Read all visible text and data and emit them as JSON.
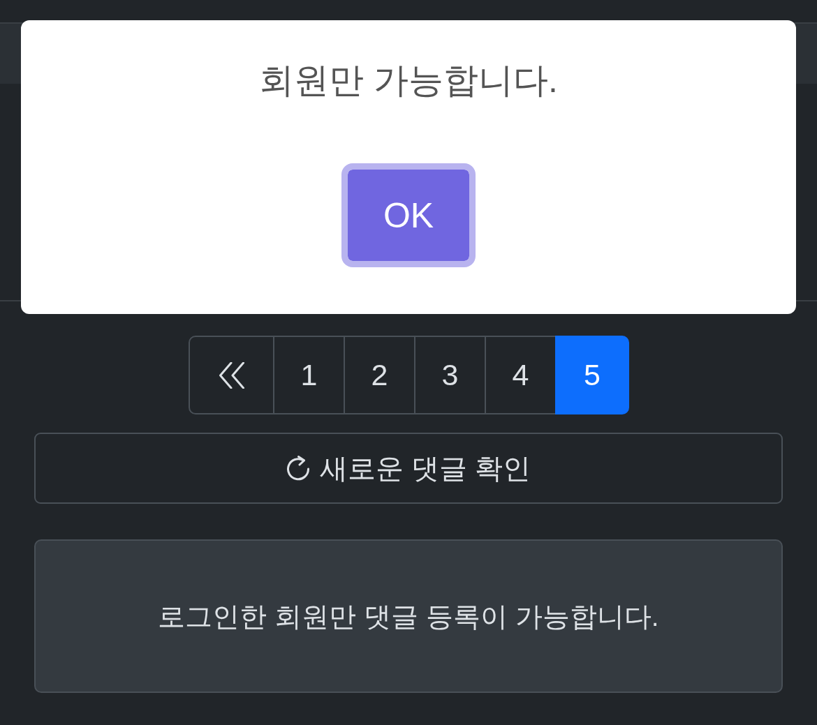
{
  "modal": {
    "title": "회원만 가능합니다.",
    "buttons": [
      {
        "label": "OK",
        "focused": true
      }
    ]
  },
  "pagination": {
    "pages": [
      {
        "label": "1",
        "selected": false
      },
      {
        "label": "2",
        "selected": false
      },
      {
        "label": "3",
        "selected": false
      },
      {
        "label": "4",
        "selected": false
      },
      {
        "label": "5",
        "selected": true
      }
    ]
  },
  "refresh_button": {
    "label": "새로운 댓글 확인"
  },
  "notice": {
    "text": "로그인한 회원만 댓글 등록이 가능합니다."
  }
}
